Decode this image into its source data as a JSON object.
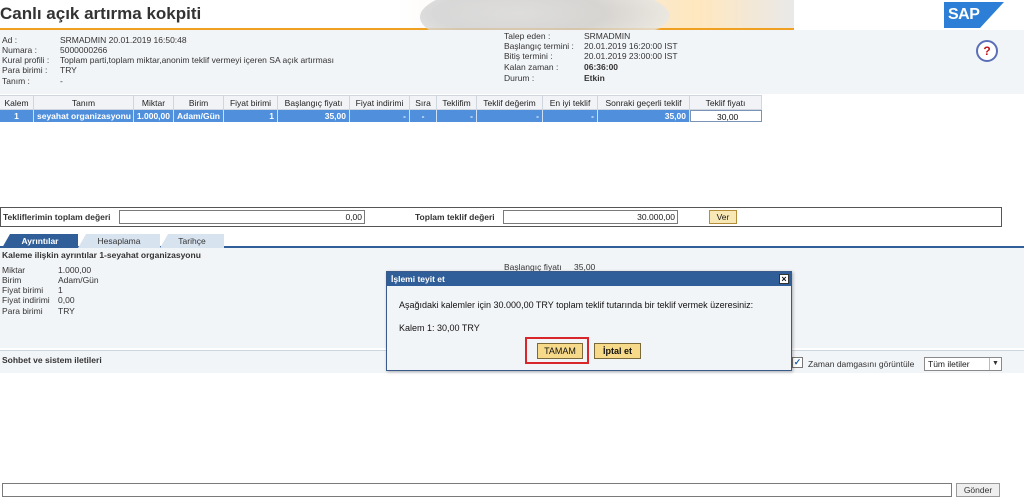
{
  "header": {
    "title": "Canlı açık artırma kokpiti",
    "logo_text": "SAP"
  },
  "info_left": [
    {
      "label": "Ad :",
      "value": "SRMADMIN 20.01.2019 16:50:48"
    },
    {
      "label": "Numara :",
      "value": "5000000266"
    },
    {
      "label": "Kural profili :",
      "value": "Toplam parti,toplam miktar,anonim teklif vermeyi içeren SA açık artırması"
    },
    {
      "label": "Para birimi :",
      "value": "TRY"
    },
    {
      "label": "Tanım :",
      "value": "-"
    }
  ],
  "info_right": [
    {
      "label": "Talep eden :",
      "value": "SRMADMIN"
    },
    {
      "label": "Başlangıç termini :",
      "value": "20.01.2019 16:20:00 IST"
    },
    {
      "label": "Bitiş termini :",
      "value": "20.01.2019 23:00:00 IST"
    },
    {
      "label": "Kalan zaman :",
      "value": "06:36:00"
    },
    {
      "label": "Durum :",
      "value": "Etkin"
    }
  ],
  "help_icon": "help-icon",
  "table": {
    "columns": [
      "Kalem",
      "Tanım",
      "Miktar",
      "Birim",
      "Fiyat birimi",
      "Başlangıç fiyatı",
      "Fiyat indirimi",
      "Sıra",
      "Teklifim",
      "Teklif değerim",
      "En iyi teklif",
      "Sonraki geçerli teklif",
      "Teklif fiyatı"
    ],
    "rows": [
      [
        "1",
        "seyahat organizasyonu",
        "1.000,00",
        "Adam/Gün",
        "1",
        "35,00",
        "-",
        "-",
        "-",
        "-",
        "-",
        "35,00",
        "30,00"
      ]
    ]
  },
  "totals": {
    "my_total_label": "Tekliflerimin toplam değeri",
    "my_total_value": "0,00",
    "bid_total_label": "Toplam teklif değeri",
    "bid_total_value": "30.000,00",
    "submit_label": "Ver"
  },
  "tabs": [
    "Ayrıntılar",
    "Hesaplama",
    "Tarihçe"
  ],
  "details": {
    "title": "Kaleme ilişkin ayrıntılar 1-seyahat organizasyonu",
    "fields": [
      {
        "label": "Miktar",
        "value": "1.000,00"
      },
      {
        "label": "Birim",
        "value": "Adam/Gün"
      },
      {
        "label": "Fiyat birimi",
        "value": "1"
      },
      {
        "label": "Fiyat indirimi",
        "value": "0,00"
      },
      {
        "label": "Para birimi",
        "value": "TRY"
      }
    ],
    "start_price_label": "Başlangıç fiyatı",
    "start_price_value": "35,00"
  },
  "chat": {
    "title": "Sohbet ve sistem iletileri",
    "timestamp_label": "Zaman damgasını görüntüle",
    "timestamp_checked": true,
    "filter_value": "Tüm iletiler",
    "send_label": "Gönder",
    "message_value": ""
  },
  "dialog": {
    "title": "İşlemi teyit et",
    "message": "Aşağıdaki kalemler için 30.000,00 TRY toplam teklif tutarında bir teklif vermek üzeresiniz:",
    "item": "Kalem 1: 30,00 TRY",
    "ok_label": "TAMAM",
    "cancel_label": "İptal et"
  },
  "colors": {
    "accent": "#2f5e99",
    "selected_row": "#4f8fdc",
    "button": "#f7d98a",
    "highlight": "#d9262b"
  }
}
